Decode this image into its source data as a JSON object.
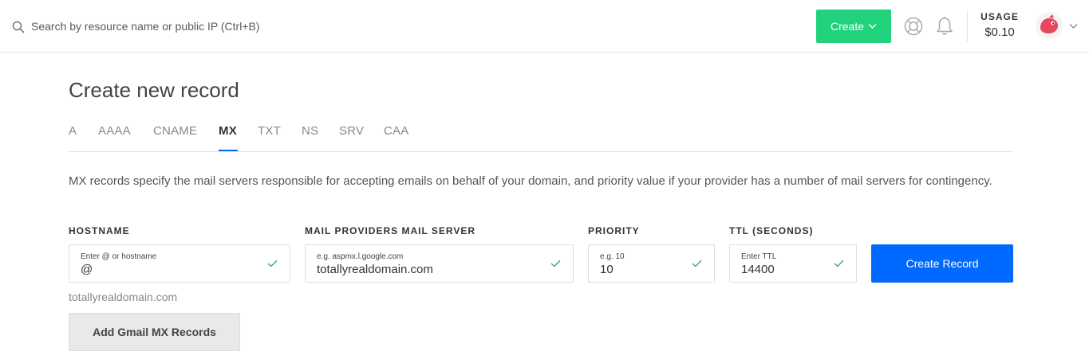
{
  "header": {
    "search_placeholder": "Search by resource name or public IP (Ctrl+B)",
    "create_label": "Create",
    "usage_label": "USAGE",
    "usage_value": "$0.10",
    "accent_color": "#1fd27b"
  },
  "page": {
    "title": "Create new record"
  },
  "tabs": [
    {
      "label": "A"
    },
    {
      "label": "AAAA"
    },
    {
      "label": "CNAME"
    },
    {
      "label": "MX",
      "active": true
    },
    {
      "label": "TXT"
    },
    {
      "label": "NS"
    },
    {
      "label": "SRV"
    },
    {
      "label": "CAA"
    }
  ],
  "description": "MX records specify the mail servers responsible for accepting emails on behalf of your domain, and priority value if your provider has a number of mail servers for contingency.",
  "form": {
    "hostname": {
      "label": "HOSTNAME",
      "hint": "Enter @ or hostname",
      "value": "@"
    },
    "mail_server": {
      "label": "MAIL PROVIDERS MAIL SERVER",
      "hint": "e.g. aspmx.l.google.com",
      "value": "totallyrealdomain.com"
    },
    "priority": {
      "label": "PRIORITY",
      "hint": "e.g. 10",
      "value": "10"
    },
    "ttl": {
      "label": "TTL (SECONDS)",
      "hint": "Enter TTL",
      "value": "14400"
    },
    "submit_label": "Create Record",
    "submit_color": "#0069ff",
    "domain_hint": "totallyrealdomain.com",
    "gmail_button_label": "Add Gmail MX Records"
  }
}
